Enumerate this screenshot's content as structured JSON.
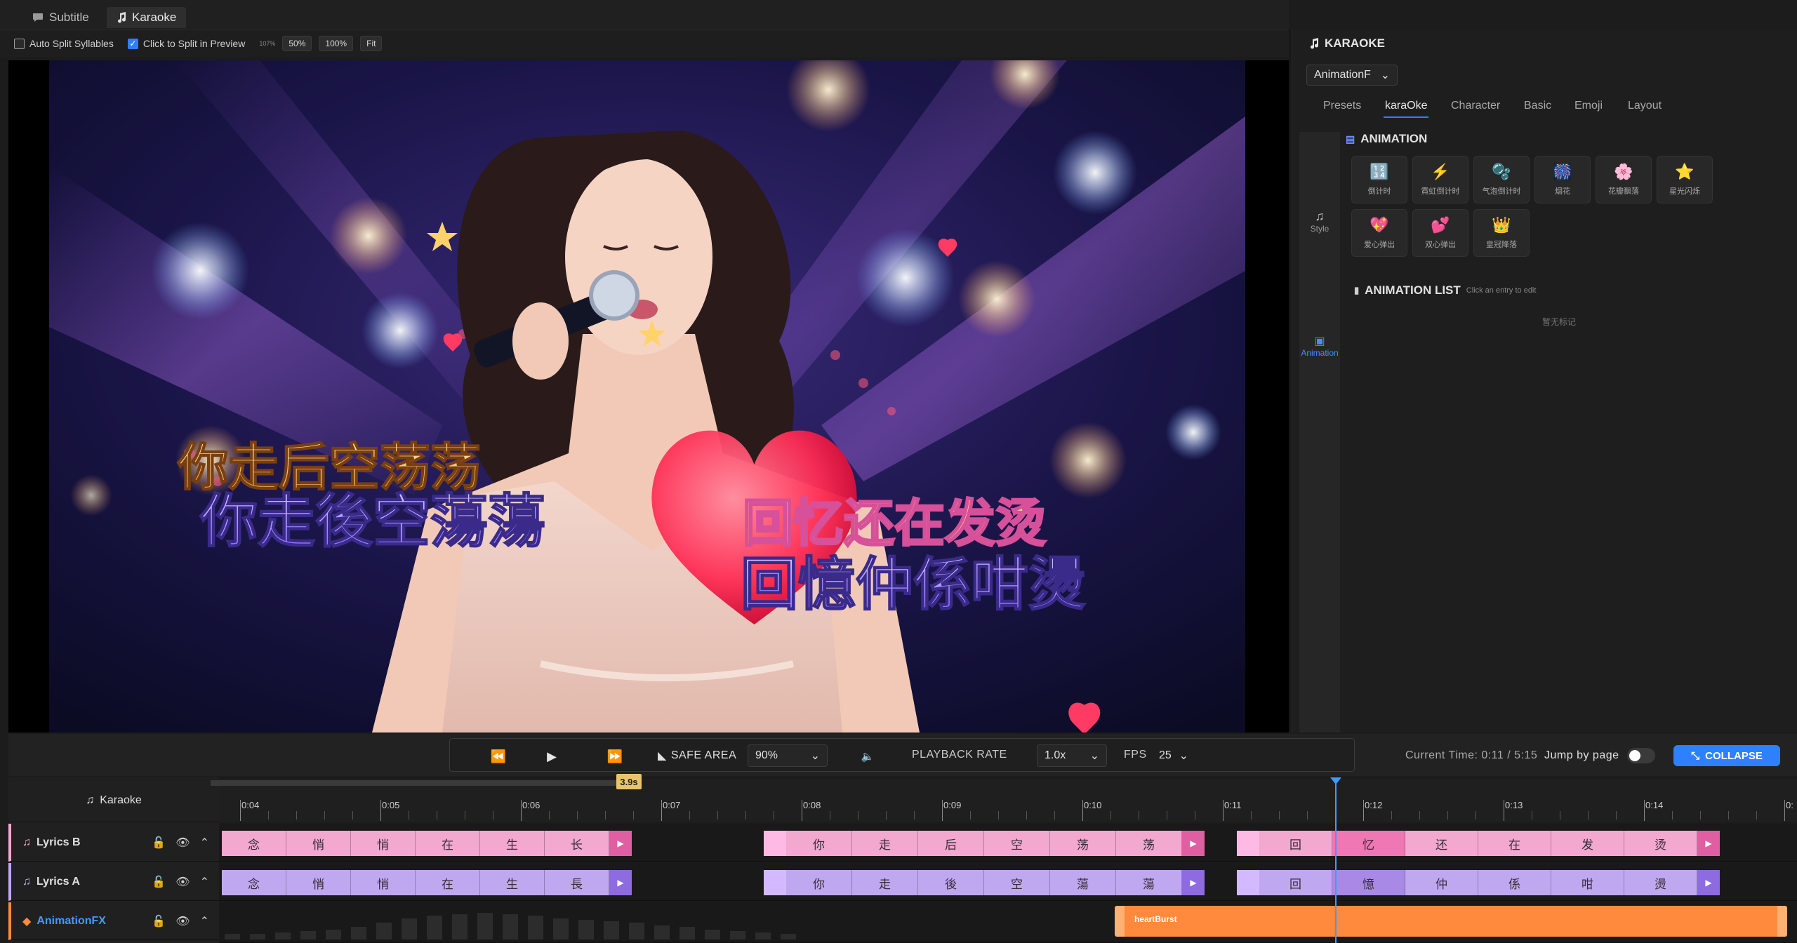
{
  "tabs": [
    {
      "label": "Subtitle"
    },
    {
      "label": "Karaoke"
    }
  ],
  "options": {
    "auto_split": {
      "label": "Auto Split Syllables",
      "checked": false
    },
    "click_split": {
      "label": "Click to Split in Preview",
      "checked": true
    },
    "zoom_readout": "107%",
    "zoom_buttons": [
      "50%",
      "100%",
      "Fit"
    ]
  },
  "preview": {
    "lyrics_top_left": "你走后空荡荡",
    "lyrics_bottom_left": "你走後空蕩蕩",
    "lyrics_top_right": "回忆还在发烫",
    "lyrics_bottom_right": "回憶仲係咁燙"
  },
  "panel": {
    "title": "KARAOKE",
    "preset_select": "AnimationF",
    "tabs": [
      "Presets",
      "karaOke",
      "Character",
      "Basic",
      "Emoji",
      "Layout"
    ],
    "active_tab": "karaOke",
    "sidebar": [
      {
        "label": "Style",
        "icon": "music-icon"
      },
      {
        "label": "Animation",
        "icon": "film-icon"
      }
    ],
    "animation_header": "ANIMATION",
    "animations": [
      {
        "label": "倒计时",
        "icon": "countdown-icon",
        "emoji": "🔢"
      },
      {
        "label": "霓虹倒计时",
        "icon": "neon-countdown-icon",
        "emoji": "⚡"
      },
      {
        "label": "气泡倒计时",
        "icon": "bubble-countdown-icon",
        "emoji": "🫧"
      },
      {
        "label": "烟花",
        "icon": "firework-icon",
        "emoji": "🎆"
      },
      {
        "label": "花瓣飘落",
        "icon": "petal-icon",
        "emoji": "🌸"
      },
      {
        "label": "星光闪烁",
        "icon": "star-icon",
        "emoji": "⭐"
      },
      {
        "label": "爱心弹出",
        "icon": "heart-pop-icon",
        "emoji": "💖"
      },
      {
        "label": "双心弹出",
        "icon": "double-heart-icon",
        "emoji": "💕"
      },
      {
        "label": "皇冠降落",
        "icon": "crown-icon",
        "emoji": "👑"
      }
    ],
    "animation_list_header": "ANIMATION LIST",
    "animation_list_hint": "Click an entry to edit",
    "animation_list_empty": "暂无标记"
  },
  "transport": {
    "safe_area_label": "SAFE AREA",
    "safe_area_value": "90%",
    "playback_rate_label": "PLAYBACK RATE",
    "playback_rate_value": "1.0x",
    "fps_label": "FPS",
    "fps_value": "25",
    "current_time_label": "Current Time: 0:11 / 5:15",
    "jump_by_page_label": "Jump by page",
    "collapse_label": "COLLAPSE"
  },
  "timeline": {
    "header_label": "Karaoke",
    "cursor_time": "3.9s",
    "ticks": [
      "0:04",
      "0:05",
      "0:06",
      "0:07",
      "0:08",
      "0:09",
      "0:10",
      "0:11",
      "0:12",
      "0:13",
      "0:14",
      "0:"
    ],
    "tracks": [
      {
        "name": "Lyrics B",
        "color": "#f2a8cf",
        "segments": [
          [
            "念",
            "悄",
            "悄",
            "在",
            "生",
            "长"
          ],
          [
            "你",
            "走",
            "后",
            "空",
            "荡",
            "荡"
          ],
          [
            "回",
            "忆",
            "还",
            "在",
            "发",
            "烫"
          ]
        ]
      },
      {
        "name": "Lyrics A",
        "color": "#c0a8f0",
        "segments": [
          [
            "念",
            "悄",
            "悄",
            "在",
            "生",
            "長"
          ],
          [
            "你",
            "走",
            "後",
            "空",
            "蕩",
            "蕩"
          ],
          [
            "回",
            "憶",
            "仲",
            "係",
            "咁",
            "燙"
          ]
        ]
      },
      {
        "name": "AnimationFX",
        "clip_label": "heartBurst"
      }
    ]
  },
  "colors": {
    "accent": "#2f80ff",
    "playhead": "#3f9bff",
    "fx_clip": "#ff8a3d",
    "lyrics_b": "#f2a8cf",
    "lyrics_a": "#c0a8f0"
  }
}
